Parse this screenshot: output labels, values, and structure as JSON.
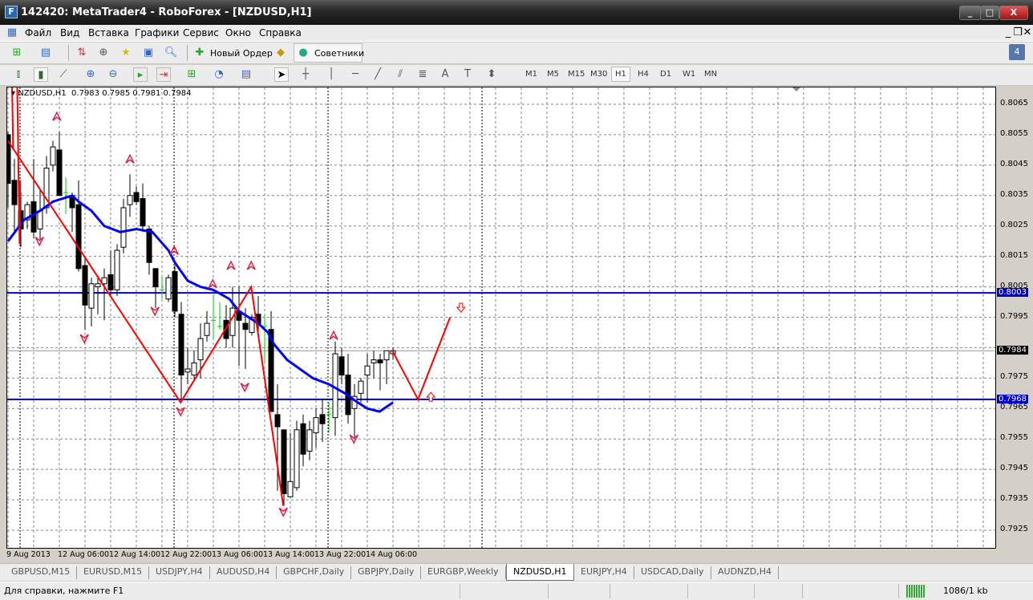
{
  "window": {
    "title": "142420: MetaTrader4 - RoboForex - [NZDUSD,H1]",
    "icon_label": "F"
  },
  "menu": [
    "Файл",
    "Вид",
    "Вставка",
    "Графики",
    "Сервис",
    "Окно",
    "Справка"
  ],
  "toolbar": {
    "new_order": "Новый Ордер",
    "experts": "Советники",
    "notifications_count": "4"
  },
  "timeframes": [
    "M1",
    "M5",
    "M15",
    "M30",
    "H1",
    "H4",
    "D1",
    "W1",
    "MN"
  ],
  "active_timeframe": "H1",
  "chart_header": "NZDUSD,H1  0.7983 0.7985 0.7981 0.7984",
  "chart_data": {
    "type": "candlestick",
    "symbol": "NZDUSD",
    "timeframe": "H1",
    "ylim": [
      0.792,
      0.8072
    ],
    "price_ticks": [
      "0.8065",
      "0.8055",
      "0.8045",
      "0.8035",
      "0.8025",
      "0.8015",
      "0.8005",
      "0.7995",
      "0.7975",
      "0.7965",
      "0.7955",
      "0.7945",
      "0.7935",
      "0.7925"
    ],
    "time_labels": [
      "9 Aug 2013",
      "12 Aug 06:00",
      "12 Aug 14:00",
      "12 Aug 22:00",
      "13 Aug 06:00",
      "13 Aug 14:00",
      "13 Aug 22:00",
      "14 Aug 06:00"
    ],
    "hlines": [
      {
        "price": 0.8003,
        "label": "0.8003",
        "color": "#0000cc"
      },
      {
        "price": 0.7968,
        "label": "0.7968",
        "color": "#0000cc"
      }
    ],
    "bid": {
      "price": 0.7984,
      "label": "0.7984"
    },
    "ohlc": [
      [
        0.8055,
        0.8056,
        0.8031,
        0.8039
      ],
      [
        0.804,
        0.8047,
        0.8023,
        0.8032
      ],
      [
        0.803,
        0.8036,
        0.8018,
        0.8024
      ],
      [
        0.8027,
        0.8033,
        0.8024,
        0.8032
      ],
      [
        0.8033,
        0.8047,
        0.8021,
        0.8023
      ],
      [
        0.8024,
        0.8037,
        0.802,
        0.803
      ],
      [
        0.8031,
        0.8048,
        0.8029,
        0.8044
      ],
      [
        0.8045,
        0.8053,
        0.8043,
        0.8051
      ],
      [
        0.805,
        0.8056,
        0.8035,
        0.8035
      ],
      [
        0.8036,
        0.8041,
        0.8029,
        0.8036
      ],
      [
        0.8035,
        0.8036,
        0.8023,
        0.8031
      ],
      [
        0.8032,
        0.804,
        0.801,
        0.8011
      ],
      [
        0.8012,
        0.8015,
        0.7991,
        0.7999
      ],
      [
        0.7998,
        0.8008,
        0.7992,
        0.8006
      ],
      [
        0.8005,
        0.8008,
        0.7996,
        0.8006
      ],
      [
        0.8006,
        0.8011,
        0.7994,
        0.8008
      ],
      [
        0.8009,
        0.8017,
        0.8002,
        0.8004
      ],
      [
        0.8004,
        0.8019,
        0.8002,
        0.8017
      ],
      [
        0.8018,
        0.8034,
        0.8016,
        0.8031
      ],
      [
        0.8032,
        0.8042,
        0.8028,
        0.8035
      ],
      [
        0.8036,
        0.8038,
        0.8032,
        0.8033
      ],
      [
        0.8034,
        0.8039,
        0.8023,
        0.8025
      ],
      [
        0.8024,
        0.8025,
        0.8009,
        0.8013
      ],
      [
        0.8011,
        0.8011,
        0.7998,
        0.8005
      ],
      [
        0.8004,
        0.8009,
        0.8001,
        0.8004
      ],
      [
        0.8001,
        0.8009,
        0.8,
        0.8008
      ],
      [
        0.801,
        0.8012,
        0.7995,
        0.7997
      ],
      [
        0.7996,
        0.8,
        0.7968,
        0.7976
      ],
      [
        0.7977,
        0.7985,
        0.7973,
        0.7978
      ],
      [
        0.7976,
        0.7984,
        0.7974,
        0.798
      ],
      [
        0.7981,
        0.7993,
        0.7975,
        0.7988
      ],
      [
        0.7989,
        0.7997,
        0.7987,
        0.7993
      ],
      [
        0.7994,
        0.8002,
        0.7988,
        0.7994
      ],
      [
        0.7992,
        0.8,
        0.7991,
        0.7992
      ],
      [
        0.7994,
        0.7999,
        0.7985,
        0.7988
      ],
      [
        0.7989,
        0.8005,
        0.7985,
        0.7998
      ],
      [
        0.7997,
        0.8005,
        0.7979,
        0.7994
      ],
      [
        0.7993,
        0.7998,
        0.7978,
        0.7991
      ],
      [
        0.799,
        0.7996,
        0.7989,
        0.7995
      ],
      [
        0.7996,
        0.8002,
        0.7989,
        0.7993
      ],
      [
        0.7992,
        0.7996,
        0.798,
        0.7992
      ],
      [
        0.7991,
        0.7997,
        0.7964,
        0.7964
      ],
      [
        0.7963,
        0.7973,
        0.7938,
        0.7959
      ],
      [
        0.7958,
        0.7958,
        0.7933,
        0.7937
      ],
      [
        0.7936,
        0.7957,
        0.7936,
        0.7941
      ],
      [
        0.7939,
        0.7961,
        0.7938,
        0.7958
      ],
      [
        0.796,
        0.7963,
        0.7946,
        0.795
      ],
      [
        0.7951,
        0.7961,
        0.7948,
        0.7958
      ],
      [
        0.7957,
        0.7965,
        0.7952,
        0.7962
      ],
      [
        0.7963,
        0.7968,
        0.7954,
        0.796
      ],
      [
        0.7963,
        0.7967,
        0.7957,
        0.7963
      ],
      [
        0.7962,
        0.7987,
        0.7956,
        0.7983
      ],
      [
        0.7982,
        0.7985,
        0.7973,
        0.7976
      ],
      [
        0.7976,
        0.7983,
        0.796,
        0.7963
      ],
      [
        0.7965,
        0.7973,
        0.7955,
        0.7969
      ],
      [
        0.797,
        0.7975,
        0.7967,
        0.7974
      ],
      [
        0.7976,
        0.7983,
        0.7967,
        0.7979
      ],
      [
        0.798,
        0.7984,
        0.7975,
        0.7981
      ],
      [
        0.7981,
        0.7983,
        0.7971,
        0.798
      ],
      [
        0.7981,
        0.7984,
        0.7973,
        0.7984
      ],
      [
        0.7983,
        0.7985,
        0.7981,
        0.7984
      ]
    ],
    "moving_average": [
      [
        0,
        0.802
      ],
      [
        2.5,
        0.8027
      ],
      [
        5,
        0.803
      ],
      [
        7,
        0.8033
      ],
      [
        10,
        0.8035
      ],
      [
        11,
        0.8033
      ],
      [
        13,
        0.803
      ],
      [
        15,
        0.8025
      ],
      [
        17.5,
        0.8023
      ],
      [
        20,
        0.8024
      ],
      [
        22.5,
        0.8023
      ],
      [
        25,
        0.8017
      ],
      [
        26,
        0.8013
      ],
      [
        28,
        0.8007
      ],
      [
        30,
        0.8005
      ],
      [
        32,
        0.8004
      ],
      [
        34.5,
        0.8001
      ],
      [
        36,
        0.7997
      ],
      [
        39,
        0.7993
      ],
      [
        40.5,
        0.799
      ],
      [
        41.5,
        0.7986
      ],
      [
        43.5,
        0.7981
      ],
      [
        45.5,
        0.7978
      ],
      [
        47.5,
        0.7975
      ],
      [
        50,
        0.7973
      ],
      [
        52.5,
        0.797
      ],
      [
        54.5,
        0.7967
      ],
      [
        56,
        0.7965
      ],
      [
        57.9,
        0.7964
      ],
      [
        60,
        0.7967
      ]
    ],
    "zigzag": [
      [
        0.6,
        0.8075
      ],
      [
        0.8,
        0.805
      ],
      [
        1.4,
        0.8075
      ],
      [
        1.8,
        0.8019
      ],
      [
        1.9,
        0.804
      ],
      [
        0,
        0.8053
      ],
      [
        26.9,
        0.7967
      ],
      [
        37.9,
        0.8005
      ],
      [
        42.9,
        0.7933
      ]
    ],
    "projection": [
      [
        59.9,
        0.7984
      ],
      [
        63.9,
        0.7968
      ],
      [
        68.9,
        0.7995
      ]
    ],
    "fractal_up": [
      [
        7.6,
        0.8061
      ],
      [
        19,
        0.8047
      ],
      [
        25.9,
        0.8017
      ],
      [
        31.9,
        0.8006
      ],
      [
        34.75,
        0.8012
      ],
      [
        37.9,
        0.8012
      ],
      [
        50.75,
        0.7989
      ]
    ],
    "fractal_down": [
      [
        4.9,
        0.802
      ],
      [
        11.9,
        0.7988
      ],
      [
        22.9,
        0.7997
      ],
      [
        26.9,
        0.7964
      ],
      [
        36.9,
        0.7972
      ],
      [
        42.9,
        0.7931
      ],
      [
        53.9,
        0.7955
      ]
    ],
    "signal_down": [
      [
        70.6,
        0.7998
      ]
    ],
    "signal_up": [
      [
        65.9,
        0.7969
      ]
    ]
  },
  "tabs": [
    "GBPUSD,M15",
    "EURUSD,M15",
    "USDJPY,H4",
    "AUDUSD,H4",
    "GBPCHF,Daily",
    "GBPJPY,Daily",
    "EURGBP,Weekly",
    "NZDUSD,H1",
    "EURJPY,H4",
    "USDCAD,Daily",
    "AUDNZD,H4"
  ],
  "active_tab": "NZDUSD,H1",
  "status": {
    "help": "Для справки, нажмите F1",
    "traffic": "1086/1 kb"
  }
}
